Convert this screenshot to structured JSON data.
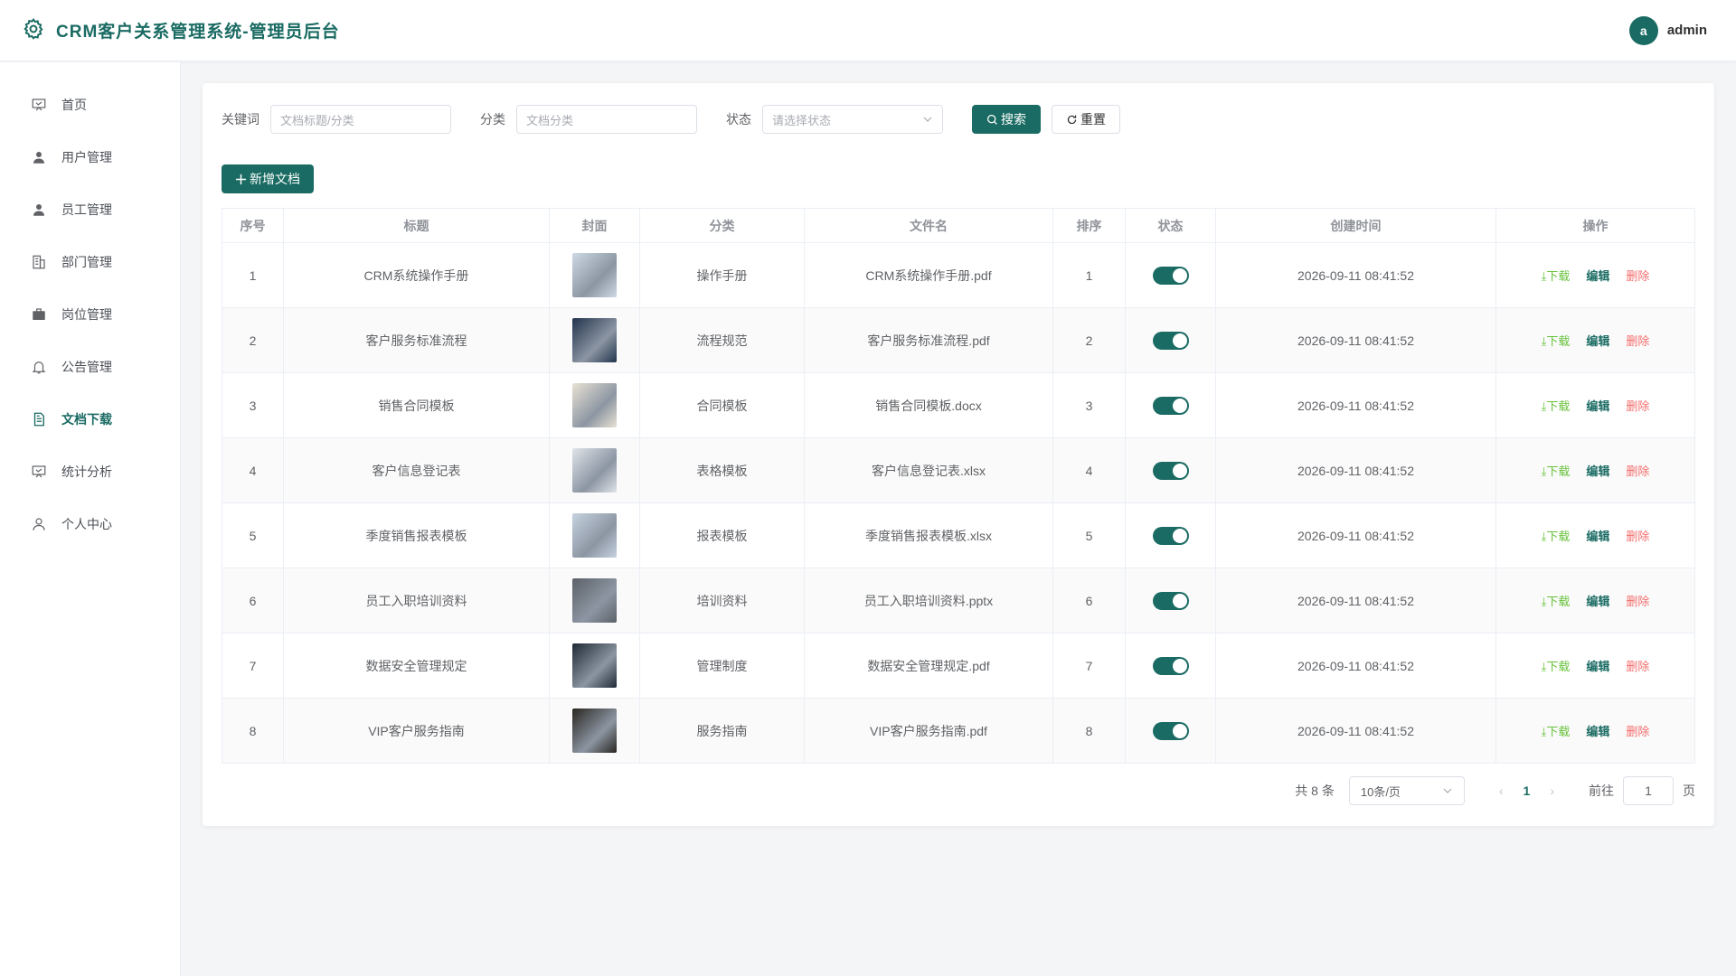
{
  "header": {
    "title": "CRM客户关系管理系统-管理员后台",
    "avatar_letter": "a",
    "username": "admin",
    "brand_color": "#1a6b63"
  },
  "sidebar": {
    "items": [
      {
        "label": "首页",
        "icon": "presentation-icon"
      },
      {
        "label": "用户管理",
        "icon": "user-icon"
      },
      {
        "label": "员工管理",
        "icon": "user-icon"
      },
      {
        "label": "部门管理",
        "icon": "building-icon"
      },
      {
        "label": "岗位管理",
        "icon": "briefcase-icon"
      },
      {
        "label": "公告管理",
        "icon": "bell-icon"
      },
      {
        "label": "文档下载",
        "icon": "document-icon",
        "active": true
      },
      {
        "label": "统计分析",
        "icon": "presentation-icon"
      },
      {
        "label": "个人中心",
        "icon": "user-outline-icon"
      }
    ]
  },
  "filters": {
    "keyword_label": "关键词",
    "keyword_placeholder": "文档标题/分类",
    "category_label": "分类",
    "category_placeholder": "文档分类",
    "status_label": "状态",
    "status_placeholder": "请选择状态",
    "search_label": "搜索",
    "reset_label": "重置"
  },
  "toolbar": {
    "add_label": "新增文档"
  },
  "table": {
    "headers": [
      "序号",
      "标题",
      "封面",
      "分类",
      "文件名",
      "排序",
      "状态",
      "创建时间",
      "操作"
    ],
    "rows": [
      {
        "no": "1",
        "title": "CRM系统操作手册",
        "category": "操作手册",
        "filename": "CRM系统操作手册.pdf",
        "sort": "1",
        "time": "2026-09-11 08:41:52"
      },
      {
        "no": "2",
        "title": "客户服务标准流程",
        "category": "流程规范",
        "filename": "客户服务标准流程.pdf",
        "sort": "2",
        "time": "2026-09-11 08:41:52"
      },
      {
        "no": "3",
        "title": "销售合同模板",
        "category": "合同模板",
        "filename": "销售合同模板.docx",
        "sort": "3",
        "time": "2026-09-11 08:41:52"
      },
      {
        "no": "4",
        "title": "客户信息登记表",
        "category": "表格模板",
        "filename": "客户信息登记表.xlsx",
        "sort": "4",
        "time": "2026-09-11 08:41:52"
      },
      {
        "no": "5",
        "title": "季度销售报表模板",
        "category": "报表模板",
        "filename": "季度销售报表模板.xlsx",
        "sort": "5",
        "time": "2026-09-11 08:41:52"
      },
      {
        "no": "6",
        "title": "员工入职培训资料",
        "category": "培训资料",
        "filename": "员工入职培训资料.pptx",
        "sort": "6",
        "time": "2026-09-11 08:41:52"
      },
      {
        "no": "7",
        "title": "数据安全管理规定",
        "category": "管理制度",
        "filename": "数据安全管理规定.pdf",
        "sort": "7",
        "time": "2026-09-11 08:41:52"
      },
      {
        "no": "8",
        "title": "VIP客户服务指南",
        "category": "服务指南",
        "filename": "VIP客户服务指南.pdf",
        "sort": "8",
        "time": "2026-09-11 08:41:52"
      }
    ],
    "ops": {
      "download": "下载",
      "edit": "编辑",
      "delete": "删除"
    }
  },
  "pagination": {
    "total": "共 8 条",
    "page_size": "10条/页",
    "current": "1",
    "goto_label": "前往",
    "goto_value": "1",
    "page_suffix": "页"
  }
}
